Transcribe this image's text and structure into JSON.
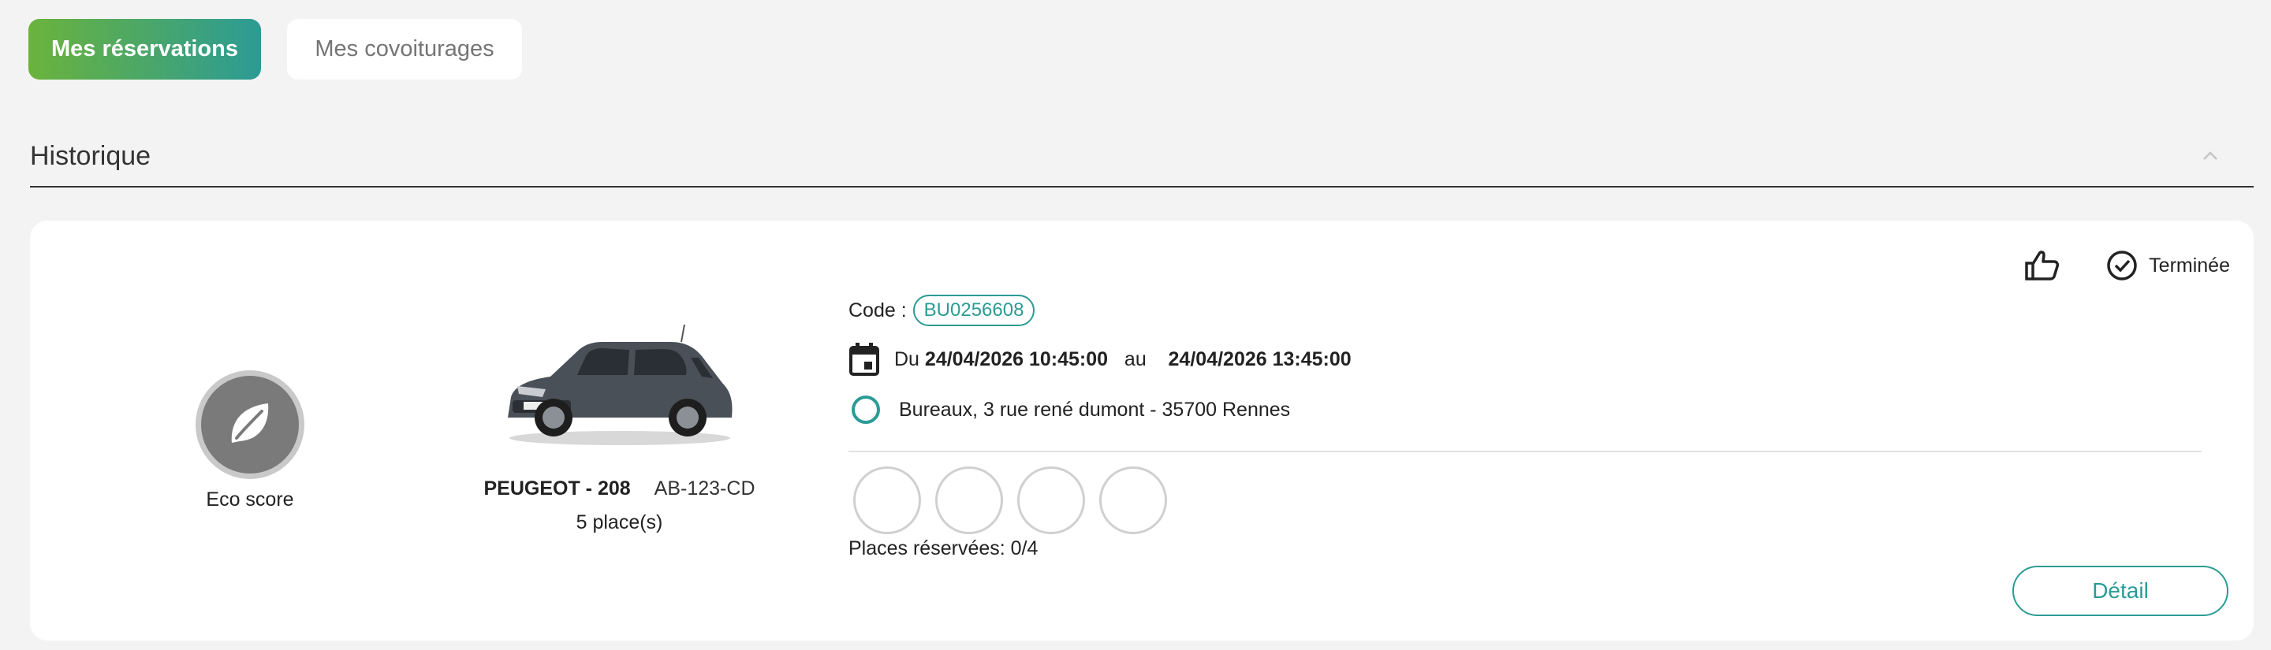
{
  "tabs": [
    {
      "label": "Mes réservations",
      "active": true
    },
    {
      "label": "Mes covoiturages",
      "active": false
    }
  ],
  "section": {
    "title": "Historique",
    "collapse_icon": "chevron-up-icon"
  },
  "reservation": {
    "eco_label": "Eco score",
    "eco_icon": "leaf-icon",
    "car": {
      "model": "PEUGEOT - 208",
      "plate": "AB-123-CD",
      "seats": "5 place(s)"
    },
    "code_label": "Code :",
    "code": "BU0256608",
    "date_prefix": "Du",
    "date_from": "24/04/2026 10:45:00",
    "date_sep": "au",
    "date_to": "24/04/2026 13:45:00",
    "address": "Bureaux, 3 rue rené dumont - 35700 Rennes",
    "places_label": "Places réservées: 0/4",
    "places_total": 4,
    "places_reserved": 0,
    "status": "Terminée",
    "detail_label": "Détail",
    "colors": {
      "accent": "#2b9b95",
      "gradient_start": "#6bb33c"
    }
  }
}
